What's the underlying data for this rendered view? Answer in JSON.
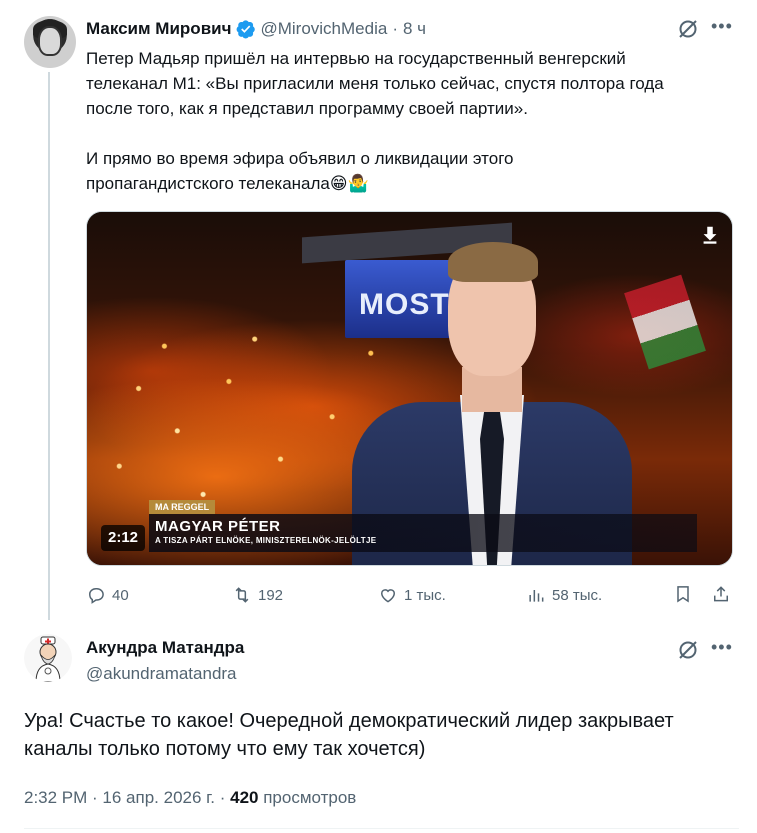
{
  "parent_tweet": {
    "author_name": "Максим Мирович",
    "handle": "@MirovichMedia",
    "separator": "·",
    "time": "8 ч",
    "text_lines": [
      "Петер Мадьяр пришёл на интервью на государственный венгерский",
      "телеканал М1: «Вы пригласили меня только сейчас, спустя полтора года",
      "после того, как я представил программу своей партии»."
    ],
    "text_lines_2": [
      "И прямо во время эфира объявил о ликвидации этого",
      "пропагандистского телеканала😁🤷‍♂️"
    ],
    "video": {
      "duration": "2:12",
      "screen_text": "MOST",
      "lower_third_tag": "MA REGGEL",
      "lower_third_name": "MAGYAR PÉTER",
      "lower_third_sub": "A TISZA PÁRT ELNÖKE, MINISZTERELNÖK-JELÖLTJE"
    },
    "actions": {
      "replies": "40",
      "reposts": "192",
      "likes": "1 тыс.",
      "views": "58 тыс."
    }
  },
  "reply_tweet": {
    "author_name": "Акундра Матандра",
    "handle": "@akundramatandra",
    "text_lines": [
      "Ура! Счастье то какое! Очередной демократический лидер закрывает",
      "каналы только потому что ему так хочется)"
    ],
    "meta_time": "2:32 PM · 16 апр. 2026 г. · ",
    "meta_views": "420",
    "meta_views_label": " просмотров"
  },
  "colors": {
    "text_primary": "#0f1419",
    "text_secondary": "#536471",
    "verified_blue": "#1d9bf0",
    "thread_line": "#cfd9de"
  },
  "icons": [
    "verified-badge-icon",
    "grok-icon",
    "more-icon",
    "download-icon",
    "reply-icon",
    "repost-icon",
    "like-icon",
    "views-icon",
    "bookmark-icon",
    "share-icon"
  ]
}
